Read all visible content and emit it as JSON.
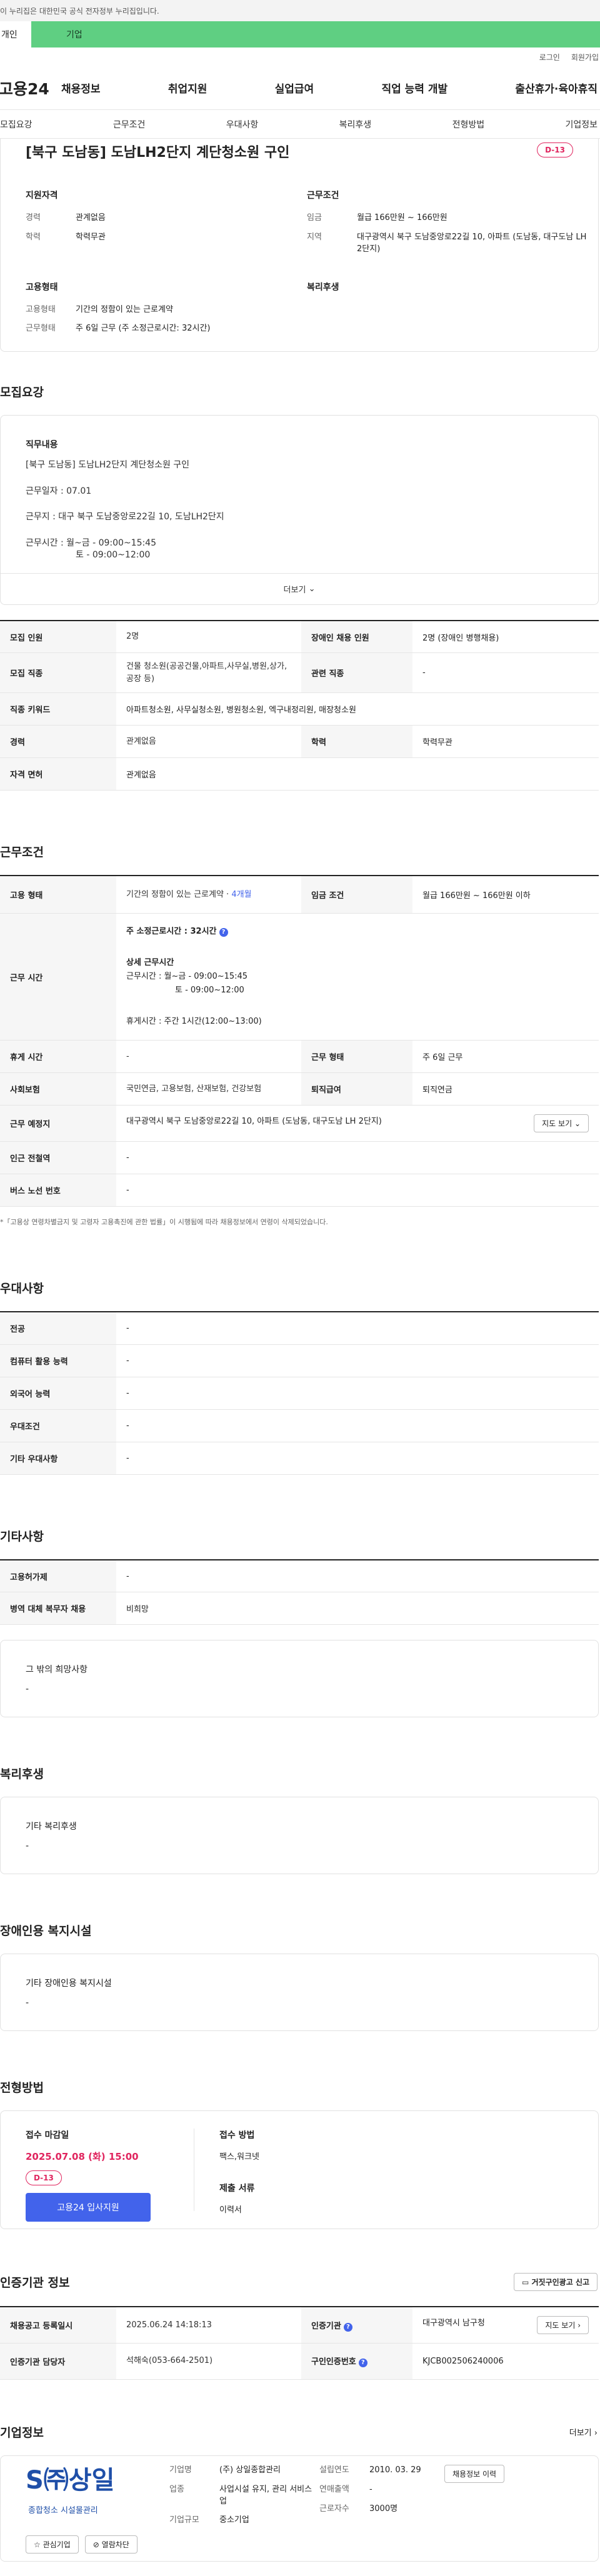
{
  "gov_banner": "이 누리집은 대한민국 공식 전자정부 누리집입니다.",
  "top_tabs": [
    "개인",
    "기업"
  ],
  "util_links": [
    "로그인",
    "회원가입"
  ],
  "logo": "고용24",
  "gnb": [
    "채용정보",
    "취업지원",
    "실업급여",
    "직업 능력 개발",
    "출산휴가·육아휴직"
  ],
  "anchor_nav": [
    "모집요강",
    "근무조건",
    "우대사항",
    "복리후생",
    "전형방법",
    "기업정보"
  ],
  "summary": {
    "title": "[북구 도남동] 도남LH2단지 계단청소원 구인",
    "dday": "D-13",
    "qual_title": "지원자격",
    "qual": [
      {
        "k": "경력",
        "v": "관계없음"
      },
      {
        "k": "학력",
        "v": "학력무관"
      }
    ],
    "work_title": "근무조건",
    "work": [
      {
        "k": "임금",
        "v": "월급 166만원 ~ 166만원"
      },
      {
        "k": "지역",
        "v": "대구광역시 북구 도남중앙로22길 10, 아파트 (도남동, 대구도남 LH 2단지)"
      }
    ],
    "emp_title": "고용형태",
    "emp": [
      {
        "k": "고용형태",
        "v": "기간의 정함이 있는 근로계약"
      },
      {
        "k": "근무형태",
        "v": "주 6일 근무 (주 소정근로시간: 32시간)"
      }
    ],
    "welfare_title": "복리후생"
  },
  "recruit": {
    "title": "모집요강",
    "duty_title": "직무내용",
    "duty_lines": [
      "[북구 도남동] 도남LH2단지 계단청소원 구인",
      "근무일자 : 07.01",
      "근무지 : 대구 북구 도남중앙로22길 10, 도남LH2단지",
      "근무시간 : 월~금 - 09:00~15:45",
      "토 - 09:00~12:00"
    ],
    "more": "더보기",
    "rows": [
      {
        "k1": "모집 인원",
        "v1": "2명",
        "k2": "장애인 채용 인원",
        "v2": "2명 (장애인 병행채용)"
      },
      {
        "k1": "모집 직종",
        "v1": "건물 청소원(공공건물,아파트,사무실,병원,상가,공장 등)",
        "k2": "관련 직종",
        "v2": "-"
      },
      {
        "k1": "직종 키워드",
        "v1": "아파트청소원, 사무실청소원, 병원청소원, 엑구내정리원, 매장청소원",
        "k2": "",
        "v2": ""
      },
      {
        "k1": "경력",
        "v1": "관계없음",
        "k2": "학력",
        "v2": "학력무관"
      },
      {
        "k1": "자격 면허",
        "v1": "관계없음",
        "k2": "",
        "v2": ""
      }
    ]
  },
  "conditions": {
    "title": "근무조건",
    "emp_type_k": "고용 형태",
    "emp_type_v": "기간의 정함이 있는 근로계약 · ",
    "emp_type_period": "4개월",
    "wage_k": "임금 조건",
    "wage_v": "월급 166만원 ~ 166만원 이하",
    "hours_k": "근무 시간",
    "hours_weekly": "주 소정근로시간 : 32시간",
    "hours_detail_title": "상세 근무시간",
    "hours_detail": [
      "근무시간 : 월~금 - 09:00~15:45",
      "토 - 09:00~12:00"
    ],
    "break": "휴게시간 : 주간 1시간(12:00~13:00)",
    "rows": [
      {
        "k1": "휴게 시간",
        "v1": "-",
        "k2": "근무 형태",
        "v2": "주 6일 근무"
      },
      {
        "k1": "사회보험",
        "v1": "국민연금, 고용보험, 산재보험, 건강보험",
        "k2": "퇴직급여",
        "v2": "퇴직연금"
      }
    ],
    "place_k": "근무 예정지",
    "place_v": "대구광역시 북구 도남중앙로22길 10, 아파트 (도남동, 대구도남 LH 2단지)",
    "map_btn": "지도 보기",
    "rows2": [
      {
        "k": "인근 전철역",
        "v": "-"
      },
      {
        "k": "버스 노선 번호",
        "v": "-"
      }
    ],
    "note": "*「고용상 연령차별금지 및 고령자 고용촉진에 관한 법률」이 시행됨에 따라 채용정보에서 연령이 삭제되었습니다."
  },
  "preferences": {
    "title": "우대사항",
    "rows": [
      {
        "k": "전공",
        "v": "-"
      },
      {
        "k": "컴퓨터 활용 능력",
        "v": "-"
      },
      {
        "k": "외국어 능력",
        "v": "-"
      },
      {
        "k": "우대조건",
        "v": "-"
      },
      {
        "k": "기타 우대사항",
        "v": "-"
      }
    ]
  },
  "others": {
    "title": "기타사항",
    "rows": [
      {
        "k": "고용허가제",
        "v": "-"
      },
      {
        "k": "병역 대체 복무자 채용",
        "v": "비희망"
      }
    ],
    "extra_title": "그 밖의 희망사항",
    "extra_v": "-"
  },
  "welfare": {
    "title": "복리후생",
    "box_title": "기타 복리후생",
    "box_v": "-"
  },
  "disabled": {
    "title": "장애인용 복지시설",
    "box_title": "기타 장애인용 복지시설",
    "box_v": "-"
  },
  "apply": {
    "title": "전형방법",
    "deadline_k": "접수 마감일",
    "deadline_v": "2025.07.08 (화) 15:00",
    "dday": "D-13",
    "btn": "고용24 입사지원",
    "method_k": "접수 방법",
    "method_v": "팩스,워크넷",
    "docs_k": "제출 서류",
    "docs_v": "이력서"
  },
  "agency": {
    "title": "인증기관 정보",
    "report_btn": "거짓구인광고 신고",
    "rows": [
      {
        "k1": "채용공고 등록일시",
        "v1": "2025.06.24 14:18:13",
        "k2": "인증기관",
        "v2": "대구광역시 남구청"
      },
      {
        "k1": "인증기관 담당자",
        "v1": "석해숙(053-664-2501)",
        "k2": "구인인증번호",
        "v2": "KJCB002506240006"
      }
    ],
    "map_btn": "지도 보기"
  },
  "company": {
    "title": "기업정보",
    "more": "더보기",
    "logo_text": "S㈜상일",
    "logo_sub": "종합청소 시설물관리",
    "btn_like": "관심기업",
    "btn_block": "열람차단",
    "jobs_btn": "채용정보 이력",
    "rows_a": [
      {
        "k": "기업명",
        "v": "(주) 상일종합관리"
      },
      {
        "k": "업종",
        "v": "사업시설 유지, 관리 서비스업"
      },
      {
        "k": "기업규모",
        "v": "중소기업"
      }
    ],
    "rows_b": [
      {
        "k": "설립연도",
        "v": "2010. 03. 29"
      },
      {
        "k": "연매출액",
        "v": "-"
      },
      {
        "k": "근로자수",
        "v": "3000명"
      }
    ]
  }
}
